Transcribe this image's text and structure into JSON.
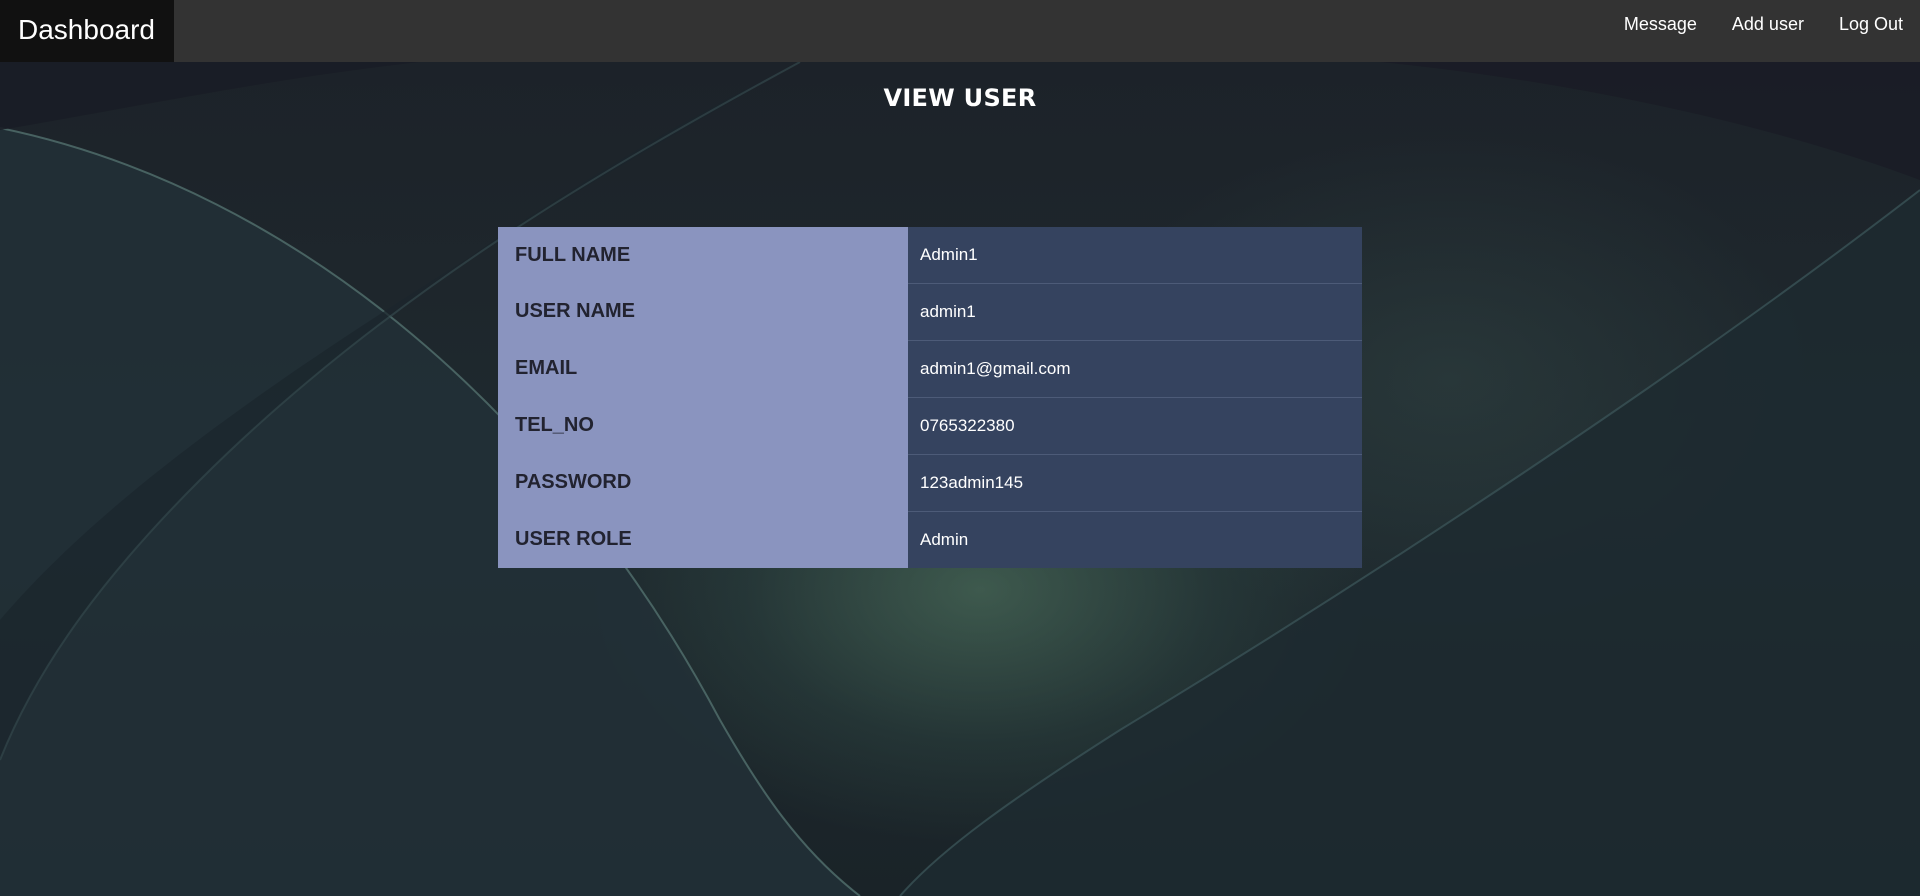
{
  "navbar": {
    "brand": "Dashboard",
    "links": [
      {
        "label": "Message"
      },
      {
        "label": "Add user"
      },
      {
        "label": "Log Out"
      }
    ]
  },
  "page": {
    "title": "VIEW USER"
  },
  "user_details": [
    {
      "label": "FULL NAME",
      "value": "Admin1"
    },
    {
      "label": "USER NAME",
      "value": "admin1"
    },
    {
      "label": "EMAIL",
      "value": "admin1@gmail.com"
    },
    {
      "label": "TEL_NO",
      "value": "0765322380"
    },
    {
      "label": "PASSWORD",
      "value": "123admin145"
    },
    {
      "label": "USER ROLE",
      "value": "Admin"
    }
  ],
  "colors": {
    "navbar": "#333333",
    "brand_bg": "#111111",
    "label_cell": "#8a94bf",
    "value_cell": "#35435f"
  }
}
